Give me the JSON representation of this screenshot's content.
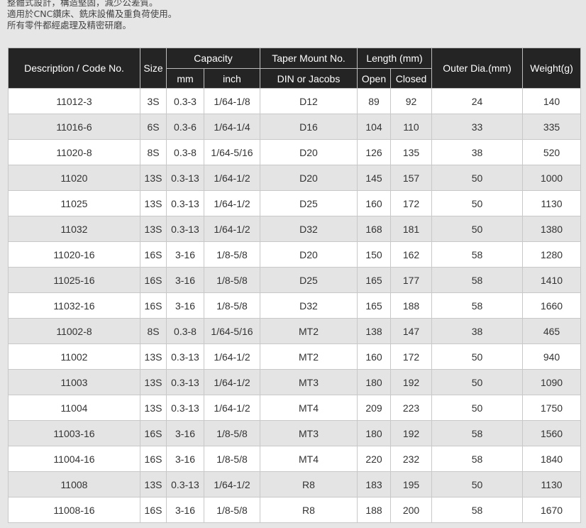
{
  "intro": {
    "lines": [
      "整體式設計，構造堅固，減少公差質。",
      "適用於CNC鑽床、銑床設備及重負荷使用。",
      "所有零件都經處理及精密研磨。"
    ]
  },
  "table": {
    "headers": {
      "description": "Description / Code No.",
      "size": "Size",
      "capacity": "Capacity",
      "capacity_mm": "mm",
      "capacity_inch": "inch",
      "taper": "Taper Mount No.",
      "taper_sub": "DIN or Jacobs",
      "length": "Length (mm)",
      "length_open": "Open",
      "length_closed": "Closed",
      "outer_dia": "Outer Dia.(mm)",
      "weight": "Weight(g)"
    },
    "rows": [
      [
        "11012-3",
        "3S",
        "0.3-3",
        "1/64-1/8",
        "D12",
        "89",
        "92",
        "24",
        "140"
      ],
      [
        "11016-6",
        "6S",
        "0.3-6",
        "1/64-1/4",
        "D16",
        "104",
        "110",
        "33",
        "335"
      ],
      [
        "11020-8",
        "8S",
        "0.3-8",
        "1/64-5/16",
        "D20",
        "126",
        "135",
        "38",
        "520"
      ],
      [
        "11020",
        "13S",
        "0.3-13",
        "1/64-1/2",
        "D20",
        "145",
        "157",
        "50",
        "1000"
      ],
      [
        "11025",
        "13S",
        "0.3-13",
        "1/64-1/2",
        "D25",
        "160",
        "172",
        "50",
        "1130"
      ],
      [
        "11032",
        "13S",
        "0.3-13",
        "1/64-1/2",
        "D32",
        "168",
        "181",
        "50",
        "1380"
      ],
      [
        "11020-16",
        "16S",
        "3-16",
        "1/8-5/8",
        "D20",
        "150",
        "162",
        "58",
        "1280"
      ],
      [
        "11025-16",
        "16S",
        "3-16",
        "1/8-5/8",
        "D25",
        "165",
        "177",
        "58",
        "1410"
      ],
      [
        "11032-16",
        "16S",
        "3-16",
        "1/8-5/8",
        "D32",
        "165",
        "188",
        "58",
        "1660"
      ],
      [
        "11002-8",
        "8S",
        "0.3-8",
        "1/64-5/16",
        "MT2",
        "138",
        "147",
        "38",
        "465"
      ],
      [
        "11002",
        "13S",
        "0.3-13",
        "1/64-1/2",
        "MT2",
        "160",
        "172",
        "50",
        "940"
      ],
      [
        "11003",
        "13S",
        "0.3-13",
        "1/64-1/2",
        "MT3",
        "180",
        "192",
        "50",
        "1090"
      ],
      [
        "11004",
        "13S",
        "0.3-13",
        "1/64-1/2",
        "MT4",
        "209",
        "223",
        "50",
        "1750"
      ],
      [
        "11003-16",
        "16S",
        "3-16",
        "1/8-5/8",
        "MT3",
        "180",
        "192",
        "58",
        "1560"
      ],
      [
        "11004-16",
        "16S",
        "3-16",
        "1/8-5/8",
        "MT4",
        "220",
        "232",
        "58",
        "1840"
      ],
      [
        "11008",
        "13S",
        "0.3-13",
        "1/64-1/2",
        "R8",
        "183",
        "195",
        "50",
        "1130"
      ],
      [
        "11008-16",
        "16S",
        "3-16",
        "1/8-5/8",
        "R8",
        "188",
        "200",
        "58",
        "1670"
      ]
    ]
  }
}
